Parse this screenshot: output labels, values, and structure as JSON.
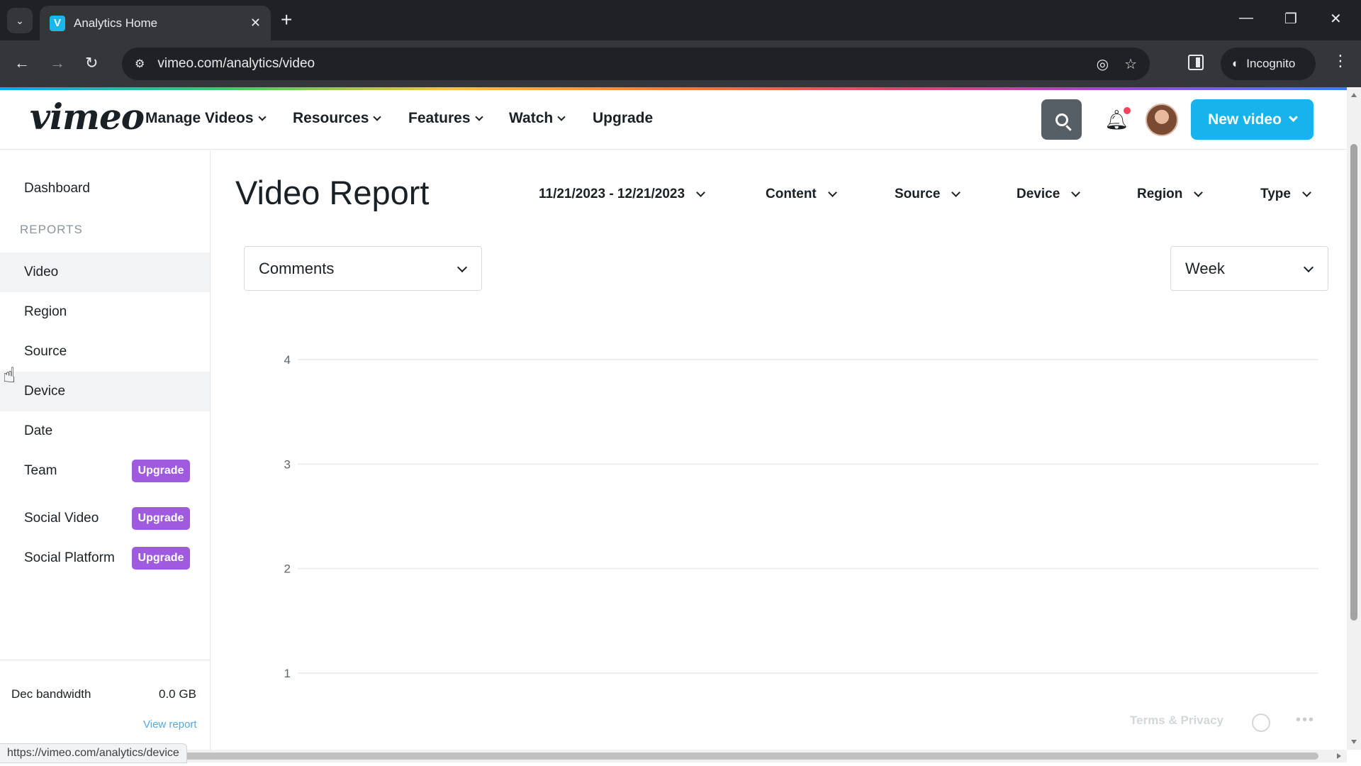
{
  "browser": {
    "tab_title": "Analytics Home",
    "tab_favicon": "V",
    "url": "vimeo.com/analytics/video",
    "incognito_label": "Incognito",
    "status_url": "https://vimeo.com/analytics/device"
  },
  "header": {
    "logo": "vimeo",
    "nav": [
      {
        "label": "Manage Videos",
        "has_dropdown": true
      },
      {
        "label": "Resources",
        "has_dropdown": true
      },
      {
        "label": "Features",
        "has_dropdown": true
      },
      {
        "label": "Watch",
        "has_dropdown": true
      },
      {
        "label": "Upgrade",
        "has_dropdown": false
      }
    ],
    "new_video_label": "New video",
    "accent_color": "#17b3ec"
  },
  "sidebar": {
    "dashboard": "Dashboard",
    "section_label": "REPORTS",
    "items": [
      {
        "label": "Video",
        "state": "active"
      },
      {
        "label": "Region",
        "state": ""
      },
      {
        "label": "Source",
        "state": ""
      },
      {
        "label": "Device",
        "state": "hover"
      },
      {
        "label": "Date",
        "state": ""
      },
      {
        "label": "Team",
        "badge": "Upgrade"
      },
      {
        "label": "Social Video",
        "badge": "Upgrade"
      },
      {
        "label": "Social Platform",
        "badge": "Upgrade"
      }
    ],
    "badge_color": "#9f5ae0",
    "bandwidth_label": "Dec bandwidth",
    "bandwidth_value": "0.0 GB",
    "view_report": "View report"
  },
  "main": {
    "title": "Video Report",
    "filters": {
      "date_range": "11/21/2023 - 12/21/2023",
      "content": "Content",
      "source": "Source",
      "device": "Device",
      "region": "Region",
      "type": "Type"
    },
    "metric_select": "Comments",
    "interval_select": "Week"
  },
  "chart_data": {
    "type": "line",
    "title": "",
    "xlabel": "",
    "ylabel": "",
    "y_ticks": [
      4,
      3,
      2,
      1
    ],
    "ylim": [
      1,
      4
    ],
    "grid": true,
    "series": []
  },
  "footer": {
    "terms": "Terms & Privacy"
  }
}
